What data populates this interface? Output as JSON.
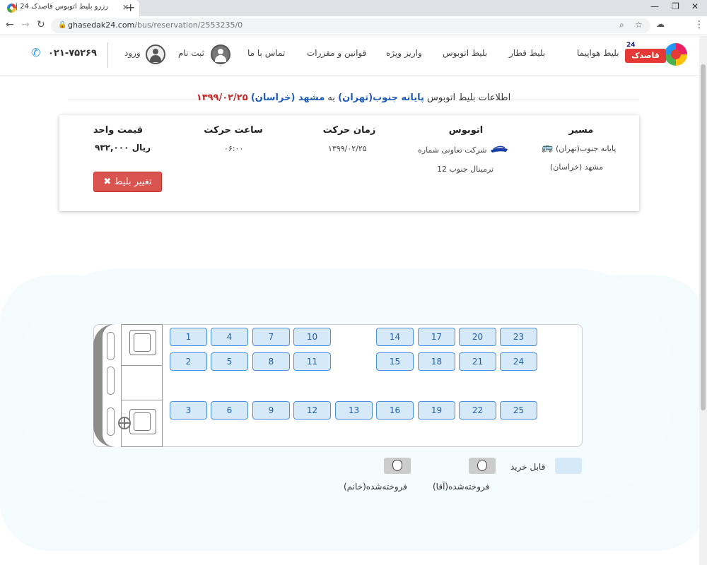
{
  "browser": {
    "tab_title": "رزرو بلیط اتوبوس قاصدک 24 |",
    "url_host": "ghasedak24.com",
    "url_path": "/bus/reservation/2553235/0"
  },
  "header": {
    "logo_text": "قاصدک",
    "logo_badge": "24",
    "menu": [
      "بلیط هواپیما",
      "بلیط قطار",
      "بلیط اتوبوس",
      "واریز ویژه",
      "قوانین و مقررات",
      "تماس با ما"
    ],
    "register_label": "ثبت نام",
    "login_label": "ورود",
    "phone": "۰۲۱-۷۵۲۶۹"
  },
  "ticket": {
    "title_prefix": "اطلاعات بلیط اتوبوس",
    "from": "پایانه جنوب(تهران)",
    "to_word": "به",
    "to": "مشهد (خراسان)",
    "date": "۱۳۹۹/۰۲/۲۵",
    "route_head": "مسیر",
    "route_from": "پایانه جنوب(تهران)",
    "route_to": "مشهد (خراسان)",
    "bus_head": "اتوبوس",
    "company": "شرکت تعاونی شماره",
    "terminal": "12 ترمینال جنوب",
    "date_head": "زمان حرکت",
    "date_val": "۱۳۹۹/۰۲/۲۵",
    "time_head": "ساعت حرکت",
    "time_val": "۰۶:۰۰",
    "price_head": "قیمت واحد",
    "price_val": "۹۳۲,۰۰۰ ریال",
    "change_label": "تغییر بلیط"
  },
  "seats": {
    "row1": [
      "1",
      "4",
      "7",
      "10",
      "14",
      "17",
      "20",
      "23"
    ],
    "row2": [
      "2",
      "5",
      "8",
      "11",
      "15",
      "18",
      "21",
      "24"
    ],
    "row3": [
      "3",
      "6",
      "9",
      "12",
      "13",
      "16",
      "19",
      "22",
      "25"
    ]
  },
  "legend": {
    "available": "قابل خرید",
    "sold_male": "فروخته‌شده(آقا)",
    "sold_female": "فروخته‌شده(خانم)"
  },
  "colors": {
    "seat_fill": "#d5e9f9",
    "seat_border": "#4a90e2",
    "change_button": "#d9534f",
    "title_blue": "#1e5bb8",
    "title_red": "#c62828"
  }
}
